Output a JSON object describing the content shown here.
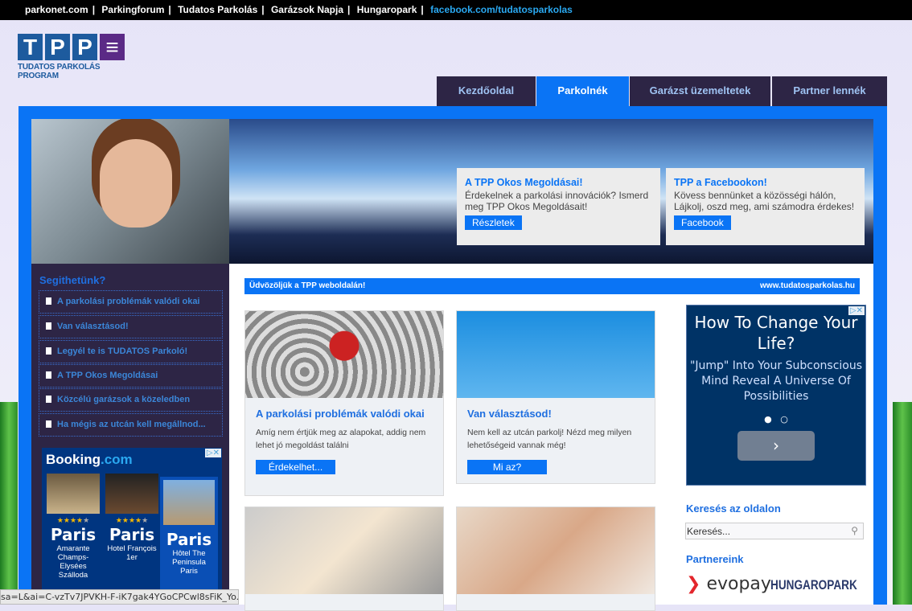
{
  "topbar": {
    "links": [
      "parkonet.com",
      "Parkingforum",
      "Tudatos Parkolás",
      "Garázsok Napja",
      "Hungaropark"
    ],
    "facebook": "facebook.com/tudatosparkolas"
  },
  "logo": {
    "letters": [
      "T",
      "P",
      "P"
    ],
    "subtitle": "TUDATOS PARKOLÁS PROGRAM"
  },
  "nav": {
    "tabs": [
      {
        "label": "Kezdőoldal"
      },
      {
        "label": "Parkolnék"
      },
      {
        "label": "Garázst üzemeltetek"
      },
      {
        "label": "Partner lennék"
      }
    ],
    "active": "Parkolnék"
  },
  "promos": [
    {
      "title": "A TPP Okos Megoldásai!",
      "text": "Érdekelnek a parkolási innovációk? Ismerd meg TPP Okos Megoldásait!",
      "button": "Részletek"
    },
    {
      "title": "TPP a Facebookon!",
      "text": "Kövess bennünket a közösségi hálón, Lájkolj, oszd meg, ami számodra érdekes!",
      "button": "Facebook"
    }
  ],
  "sidebar": {
    "title": "Segithetünk?",
    "items": [
      "A parkolási problémák valódi okai",
      "Van választásod!",
      "Legyél te is TUDATOS Parkoló!",
      "A TPP Okos Megoldásai",
      "Közcélú garázsok a közeledben",
      "Ha mégis az utcán kell megállnod..."
    ]
  },
  "booking": {
    "brand": "Booking",
    "brand_suffix": ".com",
    "hotels": [
      {
        "city": "Paris",
        "name": "Amarante Champs-Elysées Szálloda",
        "stars": 4
      },
      {
        "city": "Paris",
        "name": "Hotel François 1er",
        "stars": 4
      },
      {
        "city": "Paris",
        "name": "Hôtel The Peninsula Paris"
      }
    ]
  },
  "welcome": {
    "left": "Üdvözöljük a TPP weboldalán!",
    "right": "www.tudatosparkolas.hu"
  },
  "cards": [
    {
      "title": "A parkolási problémák valódi okai",
      "text": "Amíg nem értjük meg az alapokat, addig nem lehet jó megoldást találni",
      "button": "Érdekelhet..."
    },
    {
      "title": "Van választásod!",
      "text": "Nem kell az utcán parkolj! Nézd meg milyen lehetőségeid vannak még!",
      "button": "Mi az?"
    }
  ],
  "ad": {
    "title": "How To Change Your Life?",
    "subtitle": "\"Jump\" Into Your Subconscious Mind Reveal A Universe Of Possibilities",
    "next": "›"
  },
  "search": {
    "heading": "Keresés az oldalon",
    "placeholder": "Keresés..."
  },
  "partners": {
    "heading": "Partnereink",
    "logos": [
      "evopay",
      "HUNGAROPARK"
    ]
  },
  "status": {
    "url": "sa=L&ai=C-vzTv7JPVKH-F-iK7gak4YGoCPCwl8sFiK_Yo..."
  },
  "colors": {
    "accent": "#0a74f5",
    "dark": "#2d2545"
  }
}
